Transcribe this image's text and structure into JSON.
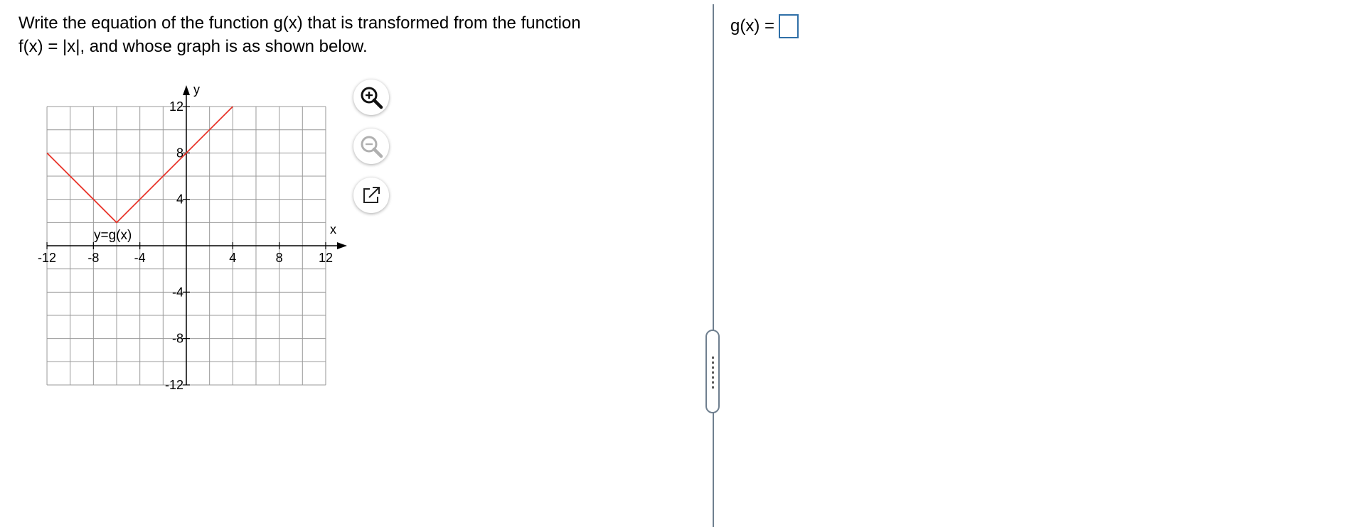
{
  "question": {
    "line1": "Write the equation of the function g(x) that is transformed from the function",
    "line2": "f(x) = |x|, and whose graph is as shown below."
  },
  "graph": {
    "x_axis_label": "x",
    "y_axis_label": "y",
    "x_ticks": [
      "-12",
      "-8",
      "-4",
      "4",
      "8",
      "12"
    ],
    "y_ticks": [
      "12",
      "8",
      "4",
      "-4",
      "-8",
      "-12"
    ],
    "curve_label": "y=g(x)",
    "line_color": "#e8342a",
    "grid_color": "#999999",
    "vertex": [
      -6,
      2
    ],
    "points": [
      [
        -12,
        8
      ],
      [
        -6,
        2
      ],
      [
        4,
        12
      ]
    ]
  },
  "tools": {
    "zoom_in_icon": "zoom-in-icon",
    "zoom_out_icon": "zoom-out-icon",
    "popout_icon": "external-link-icon"
  },
  "answer": {
    "prefix": "g(x) =",
    "value": ""
  }
}
